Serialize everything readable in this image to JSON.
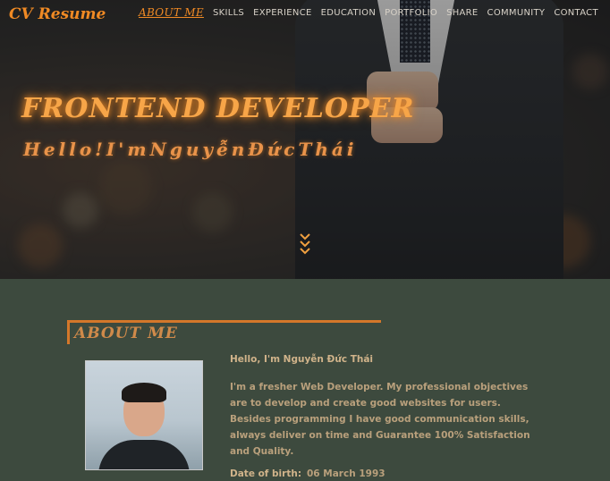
{
  "brand": {
    "logo": "CV Resume"
  },
  "nav": {
    "items": [
      "ABOUT ME",
      "SKILLS",
      "EXPERIENCE",
      "EDUCATION",
      "PORTFOLIO",
      "SHARE",
      "COMMUNITY",
      "CONTACT"
    ],
    "active": "ABOUT ME"
  },
  "hero": {
    "title": "FRONTEND DEVELOPER",
    "subtitle": "Hello!I'mNguyễnĐứcThái",
    "scroll_icon": "double-chevron-down-icon"
  },
  "about": {
    "heading": "ABOUT ME",
    "greeting": "Hello, I'm Nguyễn Đức Thái",
    "bio": "I'm a fresher Web Developer. My professional objectives are to develop and create good websites for users. Besides programming I have good communication skills, always deliver on time and Guarantee 100% Satisfaction and Quality.",
    "dob_label": "Date of birth:",
    "dob_value": "06 March 1993"
  },
  "colors": {
    "accent": "#f08a24",
    "section_bg": "#3d4a3e",
    "text_warm": "#b9a07c"
  }
}
